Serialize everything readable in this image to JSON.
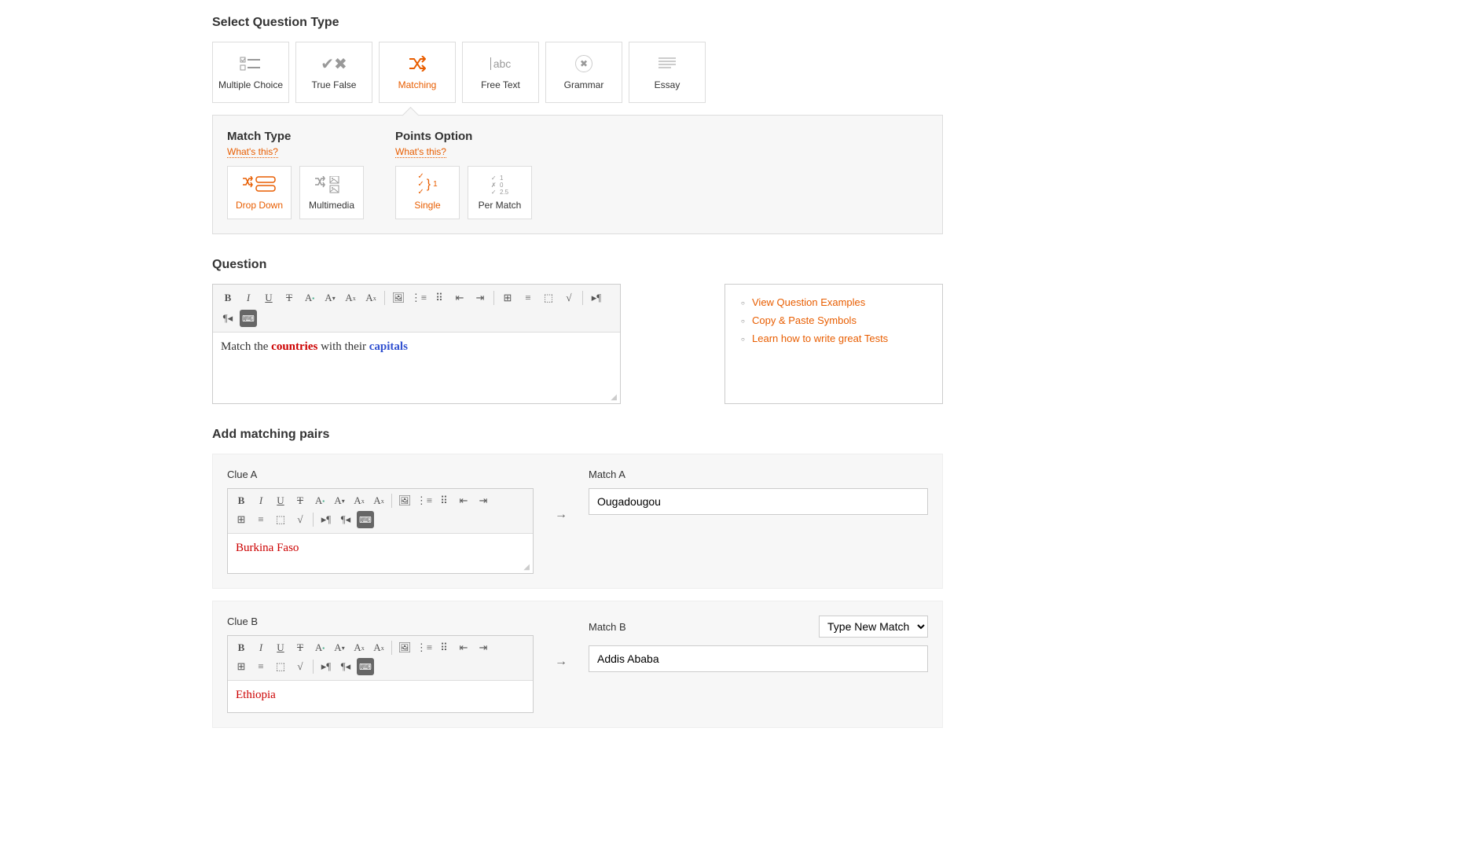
{
  "select_question_type": {
    "title": "Select Question Type",
    "types": [
      {
        "label": "Multiple Choice",
        "selected": false
      },
      {
        "label": "True False",
        "selected": false
      },
      {
        "label": "Matching",
        "selected": true
      },
      {
        "label": "Free Text",
        "selected": false
      },
      {
        "label": "Grammar",
        "selected": false
      },
      {
        "label": "Essay",
        "selected": false
      }
    ]
  },
  "match_type": {
    "title": "Match Type",
    "whats_this": "What's this?",
    "options": [
      {
        "label": "Drop Down",
        "selected": true
      },
      {
        "label": "Multimedia",
        "selected": false
      }
    ]
  },
  "points_option": {
    "title": "Points Option",
    "whats_this": "What's this?",
    "options": [
      {
        "label": "Single",
        "selected": true
      },
      {
        "label": "Per Match",
        "selected": false
      }
    ]
  },
  "question": {
    "title": "Question",
    "text_prefix": "Match the ",
    "text_bold_red": "countries",
    "text_mid": " with their ",
    "text_bold_blue": "capitals"
  },
  "help_links": {
    "items": [
      {
        "label": "View Question Examples"
      },
      {
        "label": "Copy & Paste Symbols"
      },
      {
        "label": "Learn how to write great Tests"
      }
    ]
  },
  "pairs": {
    "title": "Add matching pairs",
    "arrow": "→",
    "rows": [
      {
        "clue_label": "Clue A",
        "clue_text": "Burkina Faso",
        "match_label": "Match A",
        "match_value": "Ougadougou",
        "has_select": false
      },
      {
        "clue_label": "Clue B",
        "clue_text": "Ethiopia",
        "match_label": "Match B",
        "match_value": "Addis Ababa",
        "has_select": true,
        "select_value": "Type New Match"
      }
    ]
  },
  "toolbar": {
    "bold": "B",
    "italic": "I",
    "underline": "U",
    "strike": "T",
    "image": "🖼",
    "ol": "≡",
    "ul": "≡",
    "outdent": "⇤",
    "indent": "⇥",
    "table": "⊞",
    "align": "≡",
    "insert": "⬚",
    "sqrt": "√",
    "ltr": "¶",
    "rtl": "¶",
    "keyboard": "⌨"
  }
}
